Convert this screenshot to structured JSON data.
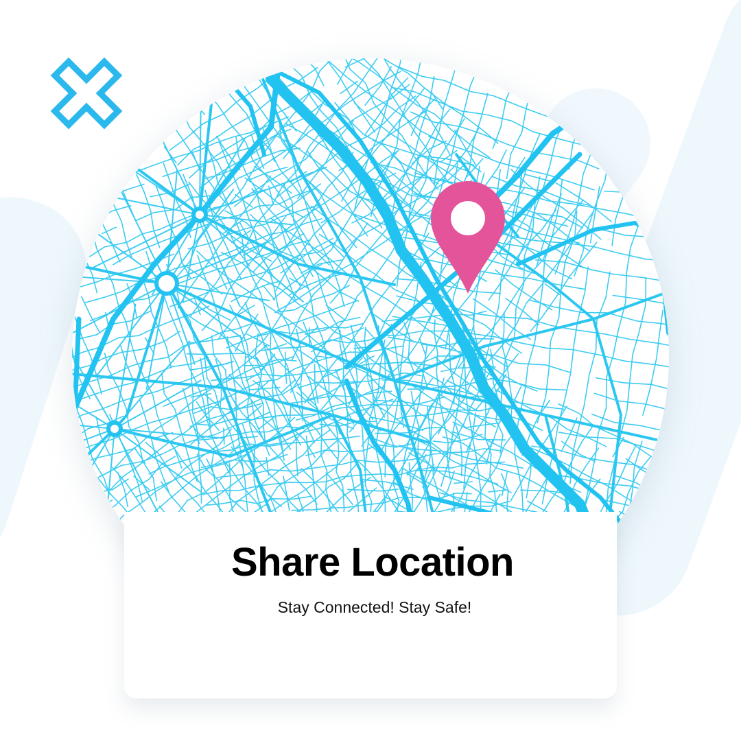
{
  "colors": {
    "map_roads": "#2cc7f0",
    "pin": "#e4549a",
    "close_icon": "#2bb8ec",
    "background_blobs": "#eef7fc"
  },
  "icons": {
    "close": "close-icon",
    "location_pin": "location-pin-icon"
  },
  "card": {
    "title": "Share Location",
    "subtitle": "Stay Connected! Stay Safe!"
  }
}
